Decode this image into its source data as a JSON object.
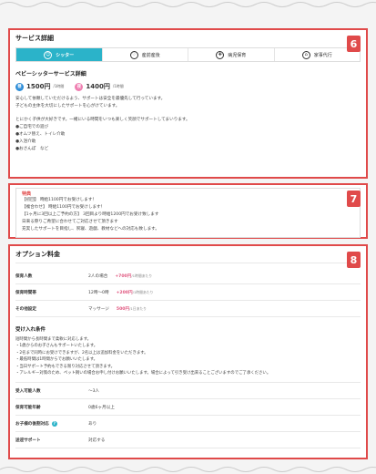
{
  "panel6": {
    "badge": "6",
    "section_title": "サービス詳細",
    "tabs": [
      {
        "label": "シッター",
        "icon": "sitter-icon"
      },
      {
        "label": "産前産後",
        "icon": "maternity-icon"
      },
      {
        "label": "病児保育",
        "icon": "sick-child-icon"
      },
      {
        "label": "家事代行",
        "icon": "housework-icon"
      }
    ],
    "service_title": "ベビーシッターサービス詳細",
    "price1": {
      "pill": "昼",
      "amount": "1500円",
      "unit": "/1時間"
    },
    "price2": {
      "pill": "夜",
      "amount": "1400円",
      "unit": "/1時間"
    },
    "lines": [
      "安心して依頼していただけるよう、サポートは安全を最優先して行っています。",
      "子どもの主体を大切にしたサポートを心がけています。",
      "",
      "とにかく子供が大好きです。一緒にいる時間をいつも楽しく笑顔でサポートしてまいります。",
      "●ご自宅での遊び",
      "●オムツ替え、トイレ介助",
      "●入浴介助",
      "●おさんぽ　など"
    ]
  },
  "panel7": {
    "badge": "7",
    "label": "特典",
    "lines": [
      "【初回】 時給1100円でお受けします！",
      "【複合わせ】 時給1100円でお受けします！",
      "【1ヶ月に3回以上ご予約の方】 3回目より時給1200円でお受け致します",
      "日来る際りご希望に合わせてご対応させて頂きます",
      "充実したサポートを目指し、夙寝、遊戯、教材などへの対応も致します。"
    ]
  },
  "panel8": {
    "badge": "8",
    "section_title": "オプション料金",
    "options": [
      {
        "key": "保育人数",
        "cond": "2人の場合",
        "price": "+700円",
        "unit": "/1時間あたり"
      },
      {
        "key": "保育時間帯",
        "cond": "12時〜0時",
        "price": "+200円",
        "unit": "/1時間あたり"
      },
      {
        "key": "その他設定",
        "cond": "マッサージ",
        "price": "500円",
        "unit": "/1日あたり"
      }
    ],
    "conditions_title": "受け入れ条件",
    "conditions": [
      "短時間から長時間まで柔軟に対応します。",
      "・1歳からのお子さんもサポートいたします。",
      "・2名まで同時にお受けできますが、2名以上は追加料金をいただきます。",
      "・最低時間は1時間からでお願いいたします。",
      "・当日サポート予約もできる限り対応させて頂きます。",
      "・アレルギー対策のため、ペット飼いの場合お申し付けお願いいたします。場合によって引き受け出来ることございますのでご了承ください。"
    ],
    "details": [
      {
        "key": "受入可能人数",
        "value": "〜3人",
        "help": false
      },
      {
        "key": "保育可能年齢",
        "value": "0歳6ヶ月以上",
        "help": false
      },
      {
        "key": "お子様の後割対応",
        "value": "あり",
        "help": true
      },
      {
        "key": "送迎サポート",
        "value": "対応する",
        "help": false
      }
    ]
  }
}
